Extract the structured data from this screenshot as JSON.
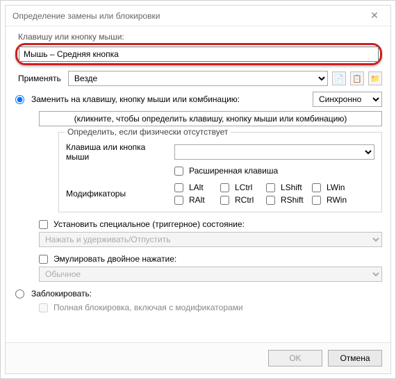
{
  "window": {
    "title": "Определение замены или блокировки"
  },
  "key_label": "Клавишу или кнопку мыши:",
  "key_value": "Мышь – Средняя кнопка",
  "apply_label": "Применять",
  "apply_value": "Везде",
  "replace": {
    "label": "Заменить на клавишу, кнопку мыши или комбинацию:",
    "sync": "Синхронно",
    "hint": "(кликните, чтобы определить клавишу, кнопку мыши или комбинацию)"
  },
  "fieldset": {
    "legend": "Определить, если физически отсутствует",
    "key_label": "Клавиша или кнопка мыши",
    "ext_label": "Расширенная клавиша",
    "mods_label": "Модификаторы",
    "mods": {
      "lalt": "LAlt",
      "lctrl": "LCtrl",
      "lshift": "LShift",
      "lwin": "LWin",
      "ralt": "RAlt",
      "rctrl": "RCtrl",
      "rshift": "RShift",
      "rwin": "RWin"
    }
  },
  "trigger": {
    "label": "Установить специальное (триггерное) состояние:",
    "value": "Нажать и удерживать/Отпустить"
  },
  "double": {
    "label": "Эмулировать двойное нажатие:",
    "value": "Обычное"
  },
  "block": {
    "label": "Заблокировать:",
    "full": "Полная блокировка, включая с модификаторами"
  },
  "buttons": {
    "ok": "OK",
    "cancel": "Отмена"
  }
}
